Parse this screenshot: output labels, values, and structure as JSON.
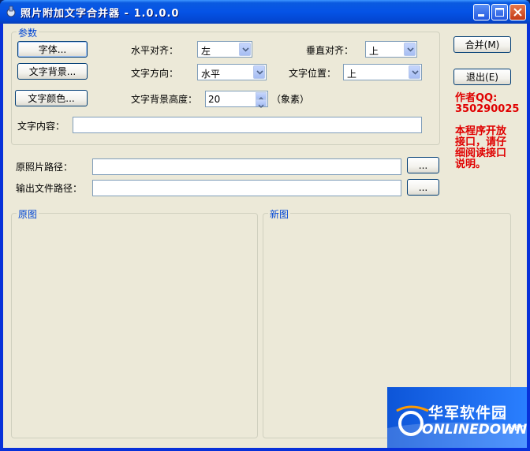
{
  "window": {
    "title": "照片附加文字合并器 - 1.0.0.0"
  },
  "params": {
    "group_title": "参数",
    "font_button": "字体...",
    "text_bg_button": "文字背景...",
    "text_color_button": "文字颜色...",
    "h_align_label": "水平对齐：",
    "h_align_value": "左",
    "v_align_label": "垂直对齐：",
    "v_align_value": "上",
    "direction_label": "文字方向：",
    "direction_value": "水平",
    "position_label": "文字位置：",
    "position_value": "上",
    "bg_height_label": "文字背景高度：",
    "bg_height_value": "20",
    "bg_height_unit": "（象素）",
    "content_label": "文字内容："
  },
  "actions": {
    "merge_button": "合并(M)",
    "exit_button": "退出(E)"
  },
  "author": {
    "qq_label": "作者QQ:",
    "qq_number": "350290025",
    "notice_line1": "本程序开放",
    "notice_line2": "接口，请仔",
    "notice_line3": "细阅读接口",
    "notice_line4": "说明。"
  },
  "paths": {
    "source_label": "原照片路径：",
    "output_label": "输出文件路径：",
    "browse_button": "..."
  },
  "previews": {
    "original_title": "原图",
    "new_title": "新图"
  },
  "watermark": {
    "cn": "华军软件园",
    "en": "ONLINEDOWN",
    "suffix": ".NET"
  }
}
